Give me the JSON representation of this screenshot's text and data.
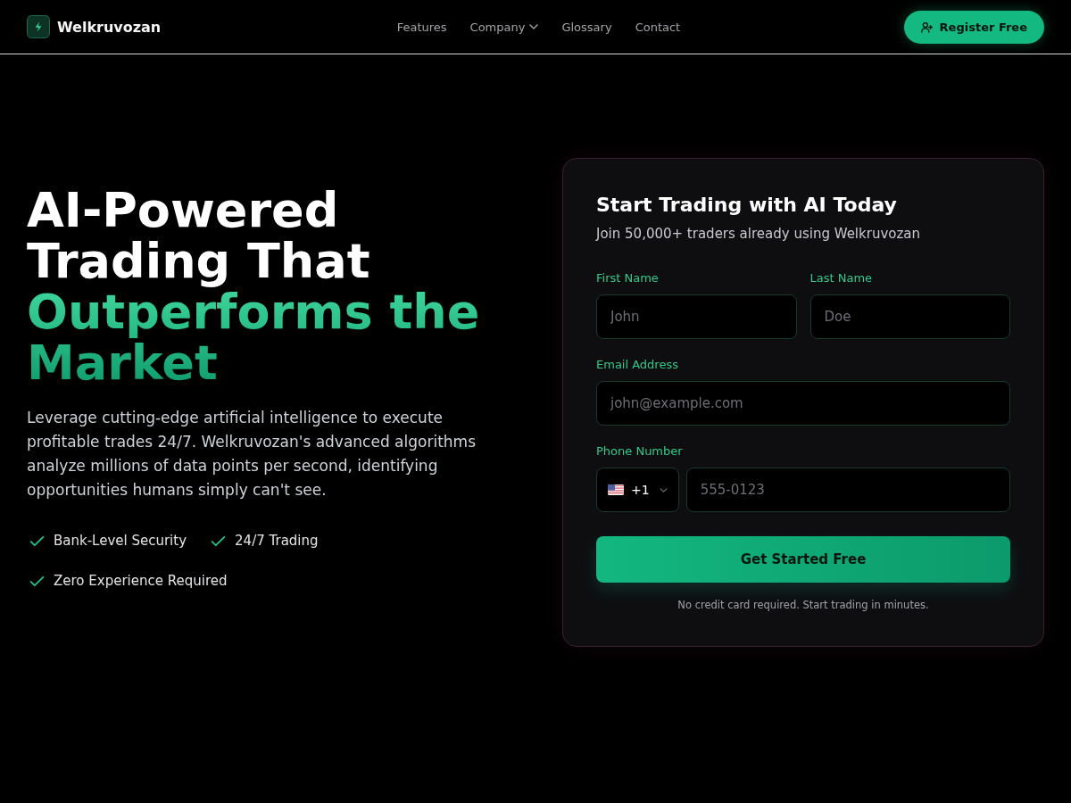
{
  "header": {
    "brand": "Welkruvozan",
    "nav": [
      {
        "label": "Features",
        "kind": "link"
      },
      {
        "label": "Company",
        "kind": "dropdown"
      },
      {
        "label": "Glossary",
        "kind": "link"
      },
      {
        "label": "Contact",
        "kind": "link"
      }
    ],
    "cta": "Register Free"
  },
  "hero": {
    "headline": "AI-Powered Trading That",
    "headline_highlight": "Outperforms the Market",
    "description": "Leverage cutting-edge artificial intelligence to execute profitable trades 24/7. Welkruvozan's advanced algorithms analyze millions of data points per second, identifying opportunities humans simply can't see.",
    "features": [
      "Bank-Level Security",
      "24/7 Trading",
      "Zero Experience Required"
    ]
  },
  "signup": {
    "title": "Start Trading with AI Today",
    "subtitle": "Join 50,000+ traders already using Welkruvozan",
    "rows": [
      {
        "fields": [
          {
            "kind": "text",
            "label": "First Name",
            "placeholder": "John"
          },
          {
            "kind": "text",
            "label": "Last Name",
            "placeholder": "Doe"
          }
        ]
      },
      {
        "fields": [
          {
            "kind": "email",
            "label": "Email Address",
            "placeholder": "john@example.com"
          }
        ]
      },
      {
        "fields": [
          {
            "kind": "phone",
            "label": "Phone Number",
            "country_code": "+1",
            "placeholder": "555-0123"
          }
        ]
      }
    ],
    "submit": "Get Started Free",
    "note": "No credit card required. Start trading in minutes."
  }
}
